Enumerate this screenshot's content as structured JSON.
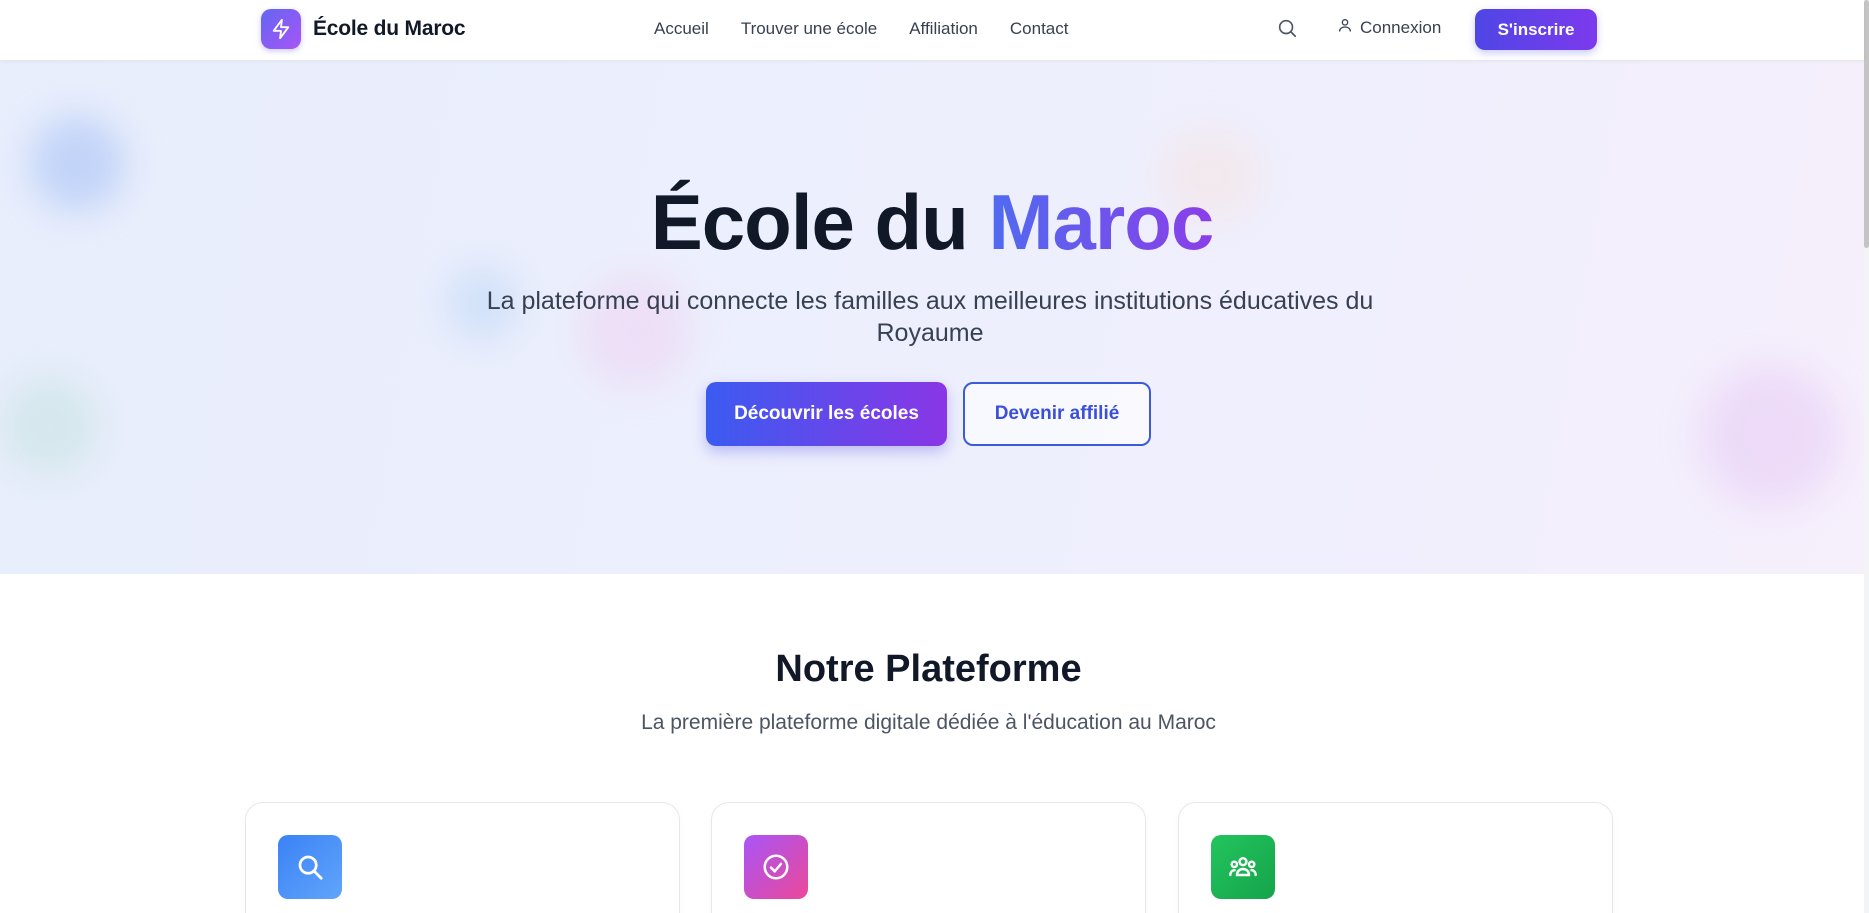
{
  "brand": {
    "name": "École du Maroc",
    "logo_icon": "lightning-bolt-icon"
  },
  "nav": {
    "links": [
      "Accueil",
      "Trouver une école",
      "Affiliation",
      "Contact"
    ],
    "search_icon": "search-icon",
    "login_label": "Connexion",
    "signup_label": "S'inscrire"
  },
  "hero": {
    "title_main": "École du ",
    "title_accent": "Maroc",
    "subtitle": "La plateforme qui connecte les familles aux meilleures institutions éducatives du Royaume",
    "primary_cta": "Découvrir les écoles",
    "secondary_cta": "Devenir affilié"
  },
  "platform": {
    "title": "Notre Plateforme",
    "subtitle": "La première plateforme digitale dédiée à l'éducation au Maroc",
    "cards": [
      {
        "icon": "search-icon",
        "color_from": "#3b82f6",
        "color_to": "#60a5fa"
      },
      {
        "icon": "check-circle-icon",
        "color_from": "#a855f7",
        "color_to": "#ec4899"
      },
      {
        "icon": "users-icon",
        "color_from": "#22c55e",
        "color_to": "#16a34a"
      }
    ]
  },
  "colors": {
    "accent": "#4f46e5",
    "accent_purple": "#7c3aed",
    "text_dark": "#111827"
  }
}
